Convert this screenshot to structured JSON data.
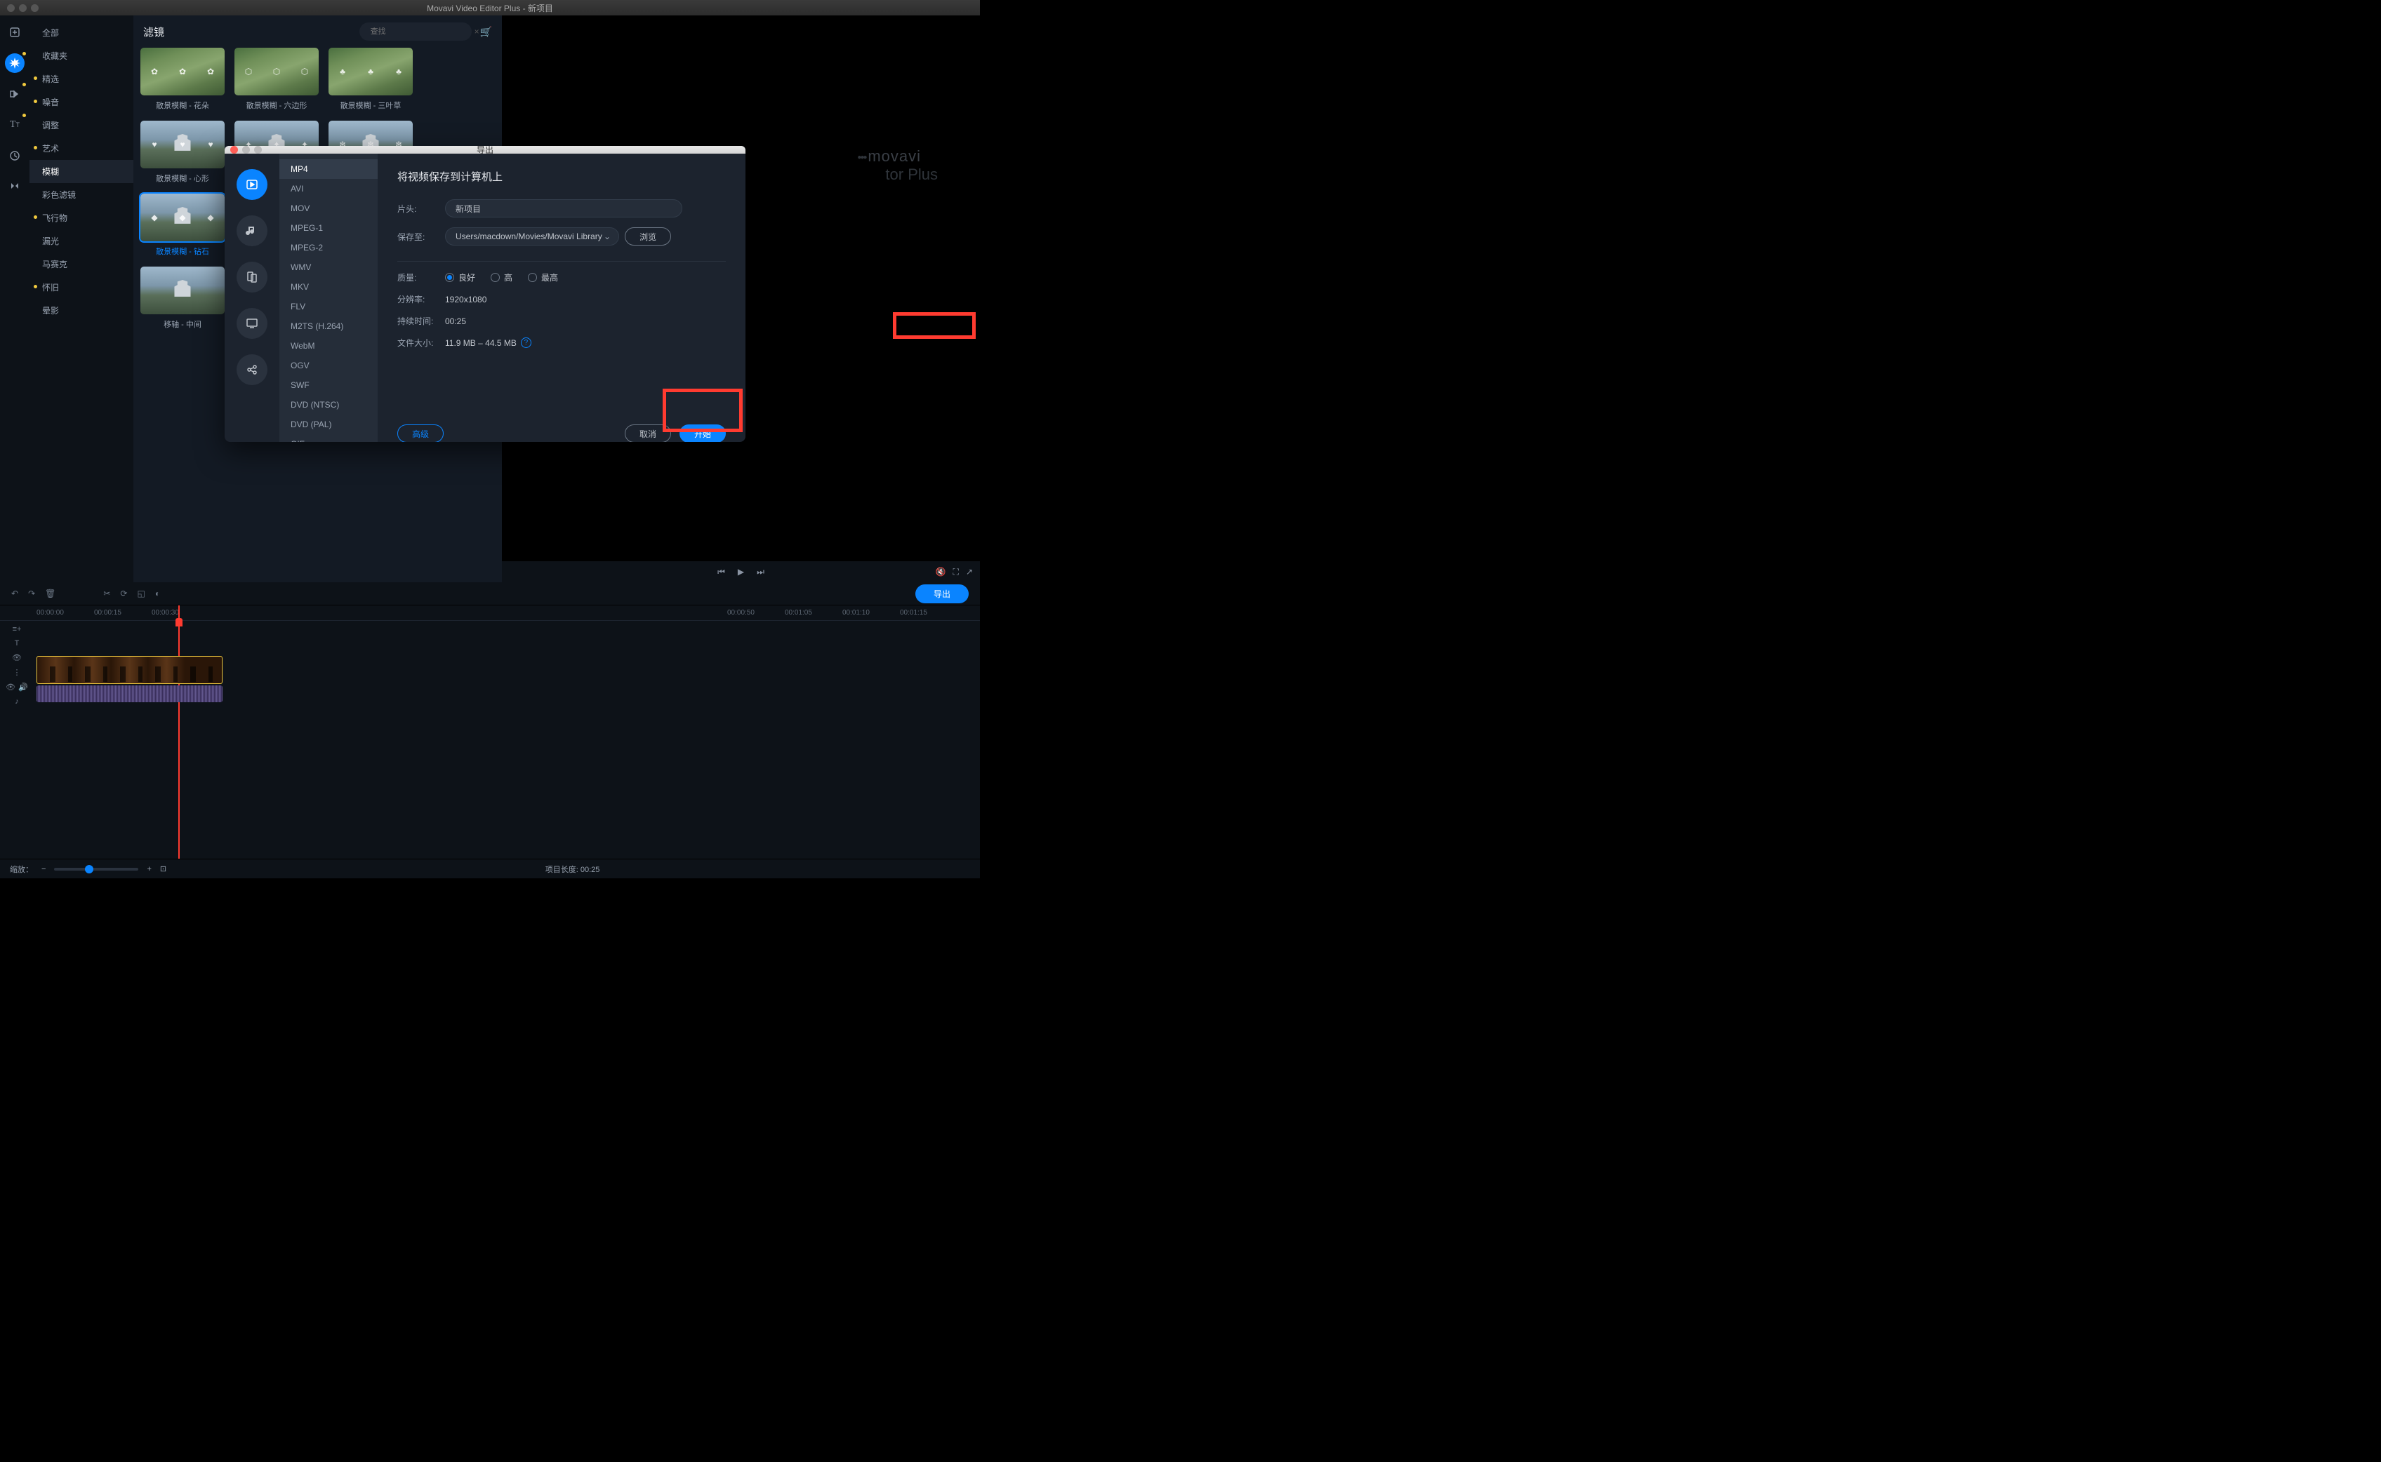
{
  "window_title": "Movavi Video Editor Plus - 新项目",
  "brand": {
    "line1": "movavi",
    "line2": "tor Plus"
  },
  "iconbar": [
    {
      "name": "media",
      "dot": false
    },
    {
      "name": "filters",
      "dot": true,
      "active": true
    },
    {
      "name": "transitions",
      "dot": true
    },
    {
      "name": "titles",
      "dot": true
    },
    {
      "name": "stickers",
      "dot": false
    },
    {
      "name": "tools",
      "dot": false
    }
  ],
  "categories": [
    {
      "label": "全部"
    },
    {
      "label": "收藏夹"
    },
    {
      "label": "精选",
      "dot": true
    },
    {
      "label": "噪音",
      "dot": true
    },
    {
      "label": "调整"
    },
    {
      "label": "艺术",
      "dot": true
    },
    {
      "label": "模糊",
      "active": true
    },
    {
      "label": "彩色滤镜"
    },
    {
      "label": "飞行物",
      "dot": true
    },
    {
      "label": "漏光"
    },
    {
      "label": "马赛克"
    },
    {
      "label": "怀旧",
      "dot": true
    },
    {
      "label": "晕影"
    }
  ],
  "gallery": {
    "title": "滤镜",
    "search_placeholder": "查找",
    "rows": [
      [
        {
          "cap": "散景模糊 - 花朵",
          "icon": "✿",
          "castle": false
        },
        {
          "cap": "散景模糊 - 六边形",
          "icon": "⬡",
          "castle": false
        },
        {
          "cap": "散景模糊 - 三叶草",
          "icon": "♣",
          "castle": false
        }
      ],
      [
        {
          "cap": "散景模糊 - 心形",
          "icon": "♥",
          "castle": true
        },
        {
          "cap": "",
          "icon": "✦",
          "castle": true
        },
        {
          "cap": "",
          "icon": "❄",
          "castle": true
        }
      ],
      [
        {
          "cap": "散景模糊 - 钻石",
          "icon": "◆",
          "castle": true,
          "selected": true
        }
      ],
      [
        {
          "cap": "移轴 - 中间",
          "icon": "",
          "castle": true
        }
      ]
    ]
  },
  "toolbar": {
    "export_label": "导出"
  },
  "timeline": {
    "ticks": [
      "00:00:00",
      "00:00:15",
      "00:00:30",
      "",
      "",
      "",
      "",
      "",
      "",
      "",
      "",
      "",
      "00:00:50",
      "00:01:05",
      "00:01:10",
      "00:01:15"
    ]
  },
  "statusbar": {
    "zoom_label": "缩放：",
    "project_label": "项目长度:",
    "project_len": "00:25"
  },
  "export_dialog": {
    "title": "导出",
    "heading": "将视频保存到计算机上",
    "formats": [
      "MP4",
      "AVI",
      "MOV",
      "MPEG-1",
      "MPEG-2",
      "WMV",
      "MKV",
      "FLV",
      "M2TS (H.264)",
      "WebM",
      "OGV",
      "SWF",
      "DVD (NTSC)",
      "DVD (PAL)",
      "GIF"
    ],
    "active_format_index": 0,
    "icon_tabs": [
      "video",
      "audio",
      "device",
      "tv",
      "share"
    ],
    "fields": {
      "name_label": "片头:",
      "name_value": "新项目",
      "saveto_label": "保存至:",
      "saveto_value": "Users/macdown/Movies/Movavi Library",
      "browse": "浏览",
      "quality_label": "质量:",
      "quality_options": [
        "良好",
        "高",
        "最高"
      ],
      "quality_selected": 0,
      "resolution_label": "分辨率:",
      "resolution_value": "1920x1080",
      "duration_label": "持续时间:",
      "duration_value": "00:25",
      "filesize_label": "文件大小:",
      "filesize_value": "11.9 MB – 44.5 MB"
    },
    "buttons": {
      "advanced": "高级",
      "cancel": "取消",
      "start": "开始"
    }
  }
}
